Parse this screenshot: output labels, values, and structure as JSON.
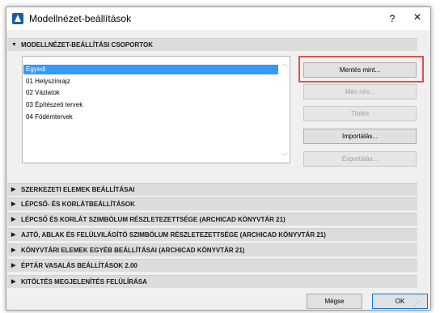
{
  "window": {
    "title": "Modellnézet-beállítások",
    "help_label": "?",
    "close_label": "×"
  },
  "groups_section": {
    "title": "MODELLNÉZET-BEÁLLÍTÁSI CSOPORTOK",
    "items": [
      "Egyedi",
      "01 Helyszínrajz",
      "02 Vázlatok",
      "03 Építészeti tervek",
      "04 Födémtervek"
    ],
    "selected_index": 0
  },
  "actions": {
    "save_as": "Mentés mint...",
    "rename": "Más név...",
    "delete": "Törlés",
    "import": "Importálás...",
    "export": "Exportálás..."
  },
  "sections": [
    "SZERKEZETI ELEMEK BEÁLLÍTÁSAI",
    "LÉPCSŐ- ÉS KORLÁTBEÁLLÍTÁSOK",
    "LÉPCSŐ ÉS KORLÁT SZIMBÓLUM RÉSZLETEZETTSÉGE (ARCHICAD KÖNYVTÁR 21)",
    "AJTÓ, ABLAK ÉS FELÜLVILÁGÍTÓ SZIMBÓLUM RÉSZLETEZETTSÉGE (ARCHICAD KÖNYVTÁR 21)",
    "KÖNYVTÁRI ELEMEK EGYÉB BEÁLLÍTÁSAI (ARCHICAD KÖNYVTÁR 21)",
    "ÉPTÁR VASALÁS BEÁLLÍTÁSOK 2.00",
    "KITÖLTÉS MEGJELENÍTÉS FELÜLÍRÁSA"
  ],
  "footer": {
    "cancel": "Mégse",
    "ok": "OK"
  },
  "colors": {
    "selection": "#3399ff",
    "highlight": "#e05050"
  }
}
